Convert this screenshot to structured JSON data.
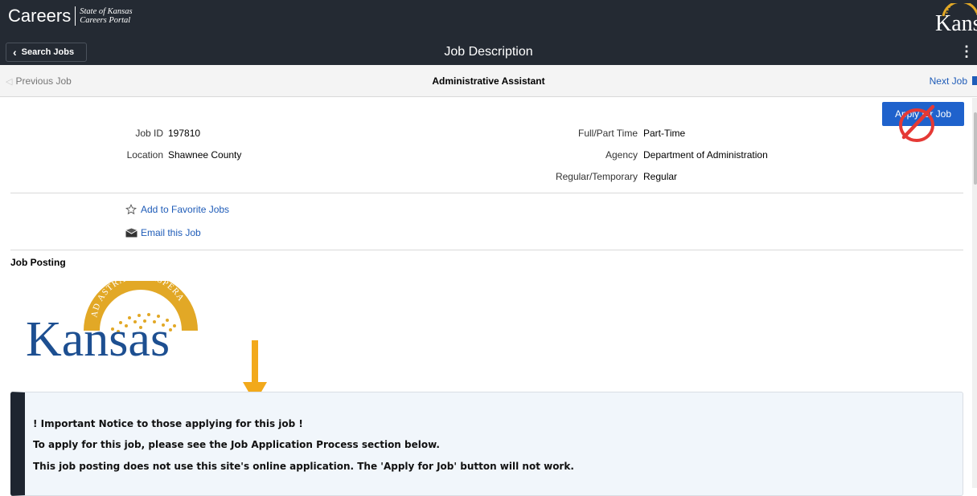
{
  "header": {
    "brand_title": "Careers",
    "brand_sub_line1": "State of Kansas",
    "brand_sub_line2": "Careers Portal",
    "logo_text": "Kansas"
  },
  "nav": {
    "back_label": "Search Jobs",
    "title": "Job Description",
    "more_icon": "⋮"
  },
  "job_nav": {
    "previous_label": "Previous Job",
    "job_title": "Administrative Assistant",
    "next_label": "Next Job"
  },
  "apply_button": "Apply for Job",
  "details": {
    "job_id_label": "Job ID",
    "job_id": "197810",
    "location_label": "Location",
    "location": "Shawnee County",
    "full_part_label": "Full/Part Time",
    "full_part": "Part-Time",
    "agency_label": "Agency",
    "agency": "Department of Administration",
    "regular_label": "Regular/Temporary",
    "regular": "Regular"
  },
  "actions": {
    "favorite_label": "Add to Favorite Jobs",
    "email_label": "Email this Job"
  },
  "posting": {
    "section_title": "Job Posting",
    "logo_motto": "AD ASTRA PER ASPERA",
    "logo_word": "Kansas"
  },
  "notice": {
    "line1": "! Important Notice to those applying for this job !",
    "line2": "To apply for this job, please see the Job Application Process section below.",
    "line3": "This job posting does not use this site's online application. The 'Apply for Job' button will not work."
  },
  "colors": {
    "header_bg": "#242a33",
    "link": "#1f5cb8",
    "apply_bg": "#1f62cc",
    "kansas_blue": "#1d4f91",
    "kansas_gold": "#e2a826",
    "arrow": "#f2a91b",
    "no_sign": "#e53935"
  }
}
